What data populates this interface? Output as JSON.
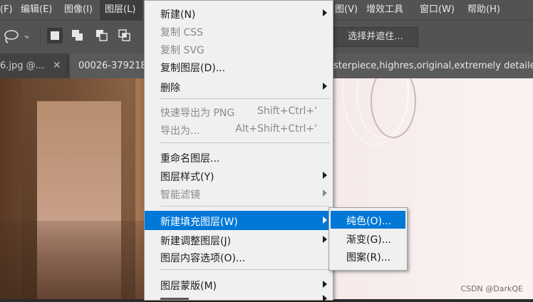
{
  "menubar": {
    "items": [
      "(F)",
      "编辑(E)",
      "图像(I)",
      "图层(L)",
      "图(V)",
      "增效工具",
      "窗口(W)",
      "帮助(H)"
    ]
  },
  "optbar": {
    "lasso_icon": "lasso-icon",
    "select_mask_label": "选择并遮住..."
  },
  "tabs": [
    {
      "label": "6.jpg @..."
    },
    {
      "label": "00026-379218"
    },
    {
      "label": "sterpiece,highres,original,extremely detailed"
    }
  ],
  "layer_menu": {
    "items": [
      {
        "label": "新建(N)",
        "shortcut": "",
        "submenu": true,
        "disabled": false
      },
      {
        "label": "复制 CSS",
        "shortcut": "",
        "submenu": false,
        "disabled": true
      },
      {
        "label": "复制 SVG",
        "shortcut": "",
        "submenu": false,
        "disabled": true
      },
      {
        "label": "复制图层(D)...",
        "shortcut": "",
        "submenu": false,
        "disabled": false
      },
      {
        "label": "删除",
        "shortcut": "",
        "submenu": true,
        "disabled": false
      },
      {
        "label": "快速导出为 PNG",
        "shortcut": "Shift+Ctrl+'",
        "submenu": false,
        "disabled": true
      },
      {
        "label": "导出为...",
        "shortcut": "Alt+Shift+Ctrl+'",
        "submenu": false,
        "disabled": true
      },
      {
        "label": "重命名图层...",
        "shortcut": "",
        "submenu": false,
        "disabled": false
      },
      {
        "label": "图层样式(Y)",
        "shortcut": "",
        "submenu": true,
        "disabled": false
      },
      {
        "label": "智能滤镜",
        "shortcut": "",
        "submenu": true,
        "disabled": true
      },
      {
        "label": "新建填充图层(W)",
        "shortcut": "",
        "submenu": true,
        "disabled": false,
        "highlighted": true
      },
      {
        "label": "新建调整图层(J)",
        "shortcut": "",
        "submenu": true,
        "disabled": false
      },
      {
        "label": "图层内容选项(O)...",
        "shortcut": "",
        "submenu": false,
        "disabled": false
      },
      {
        "label": "图层蒙版(M)",
        "shortcut": "",
        "submenu": true,
        "disabled": false
      }
    ]
  },
  "fill_submenu": {
    "items": [
      {
        "label": "纯色(O)...",
        "highlighted": true
      },
      {
        "label": "渐变(G)..."
      },
      {
        "label": "图案(R)..."
      }
    ]
  },
  "watermark": "CSDN @DarkQE",
  "colors": {
    "highlight": "#0078d7",
    "menu_bg": "#f0f0f0",
    "app_bar": "#535353"
  }
}
